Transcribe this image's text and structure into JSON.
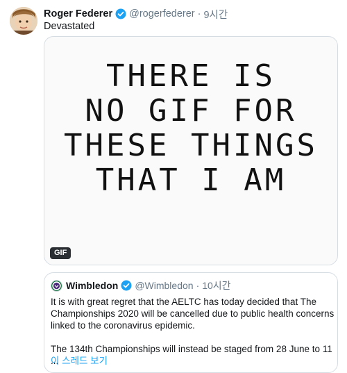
{
  "tweet": {
    "author_name": "Roger Federer",
    "author_handle": "@rogerfederer",
    "separator": "·",
    "time": "9시간",
    "text": "Devastated",
    "gif": {
      "lines": [
        "THERE IS",
        "NO GIF FOR",
        "THESE THINGS",
        "THAT I AM"
      ],
      "badge": "GIF"
    }
  },
  "quoted": {
    "author_name": "Wimbledon",
    "author_handle": "@Wimbledon",
    "separator": "·",
    "time": "10시간",
    "paragraph_1": "It is with great regret that the AELTC has today decided that The Championships 2020 will be cancelled due to public health concerns linked to the coronavirus epidemic.",
    "paragraph_2": "The 134th Championships will instead be staged from 28 June to 11 ...",
    "thread_link": "이 스레드 보기"
  },
  "colors": {
    "verified": "#1da1f2",
    "link": "#1da1f2",
    "secondary_text": "#657786"
  },
  "icons": {
    "verified": "verified-badge-icon",
    "wimbledon_logo": "wimbledon-logo-icon"
  }
}
